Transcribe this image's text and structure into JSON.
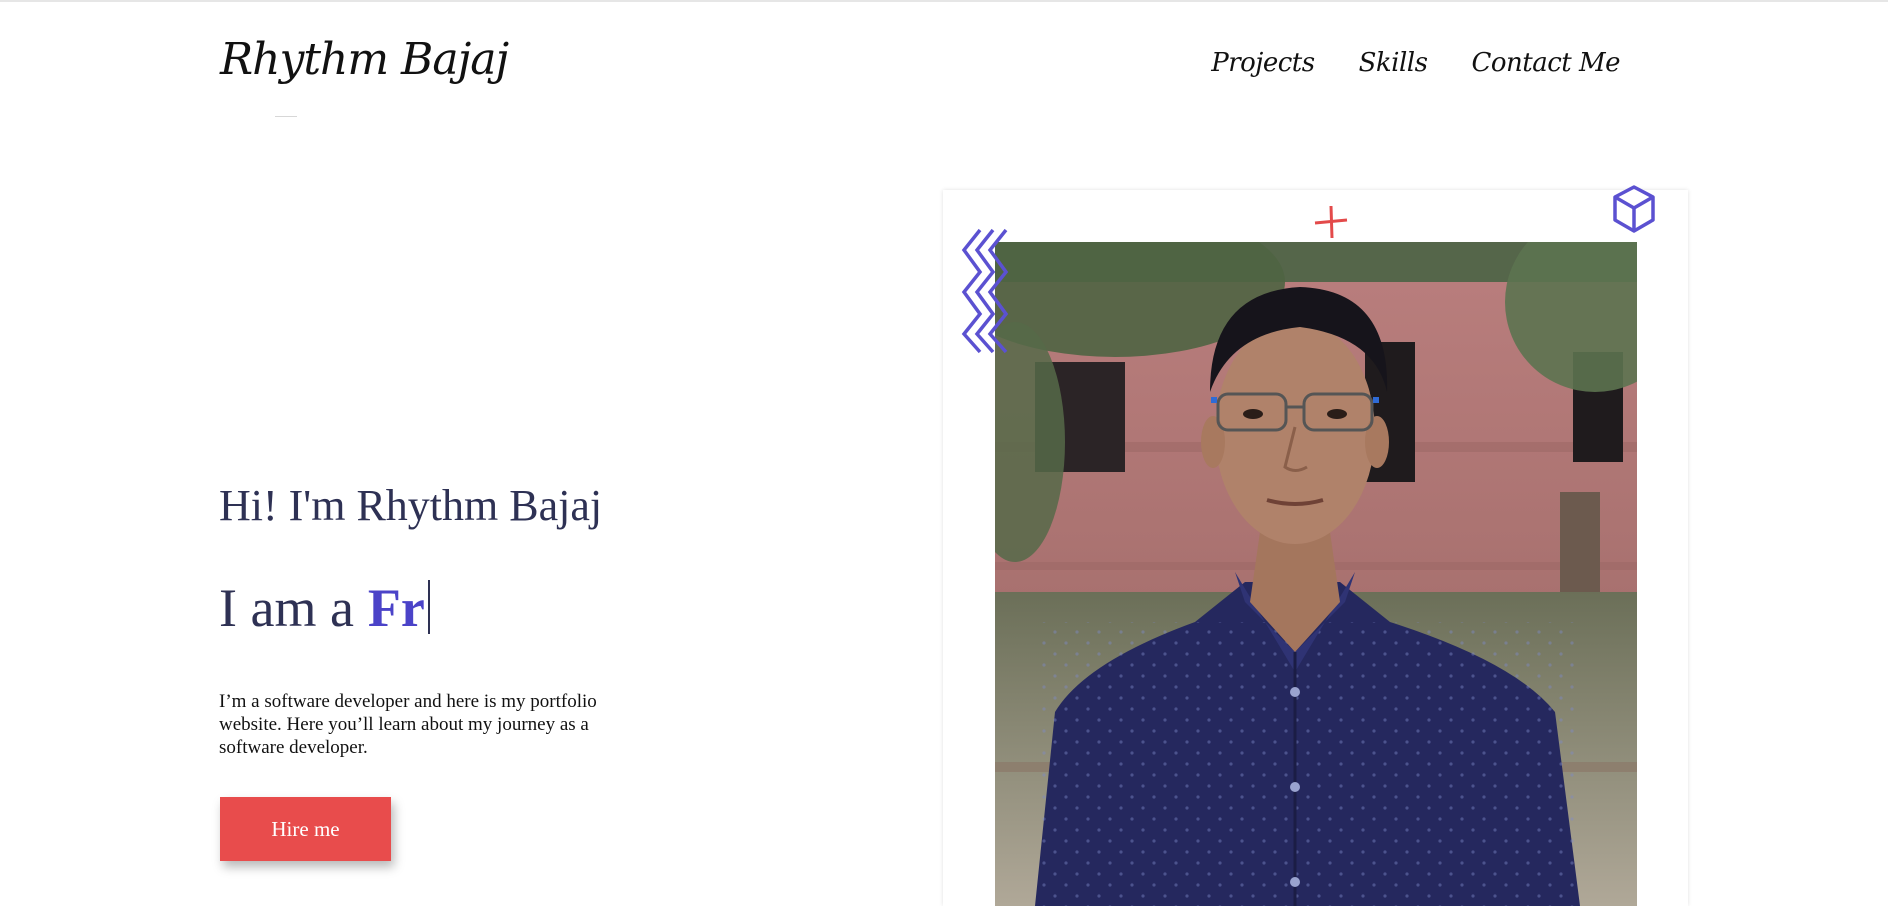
{
  "header": {
    "logo": "Rhythm Bajaj",
    "nav": [
      {
        "label": "Projects"
      },
      {
        "label": "Skills"
      },
      {
        "label": "Contact Me"
      }
    ]
  },
  "hero": {
    "greeting": "Hi! I'm Rhythm Bajaj",
    "role_prefix": "I am a",
    "role_typed": "Fr",
    "description": "I’m a software developer and here is my portfolio website. Here you’ll learn about my journey as a software developer.",
    "cta_label": "Hire me"
  },
  "colors": {
    "accent": "#4b43c8",
    "button": "#e84c4c",
    "heading": "#2e3154"
  },
  "decorations": [
    "zigzag-icon",
    "plus-icon",
    "cube-icon"
  ],
  "photo": {
    "subject": "portrait-photo"
  }
}
